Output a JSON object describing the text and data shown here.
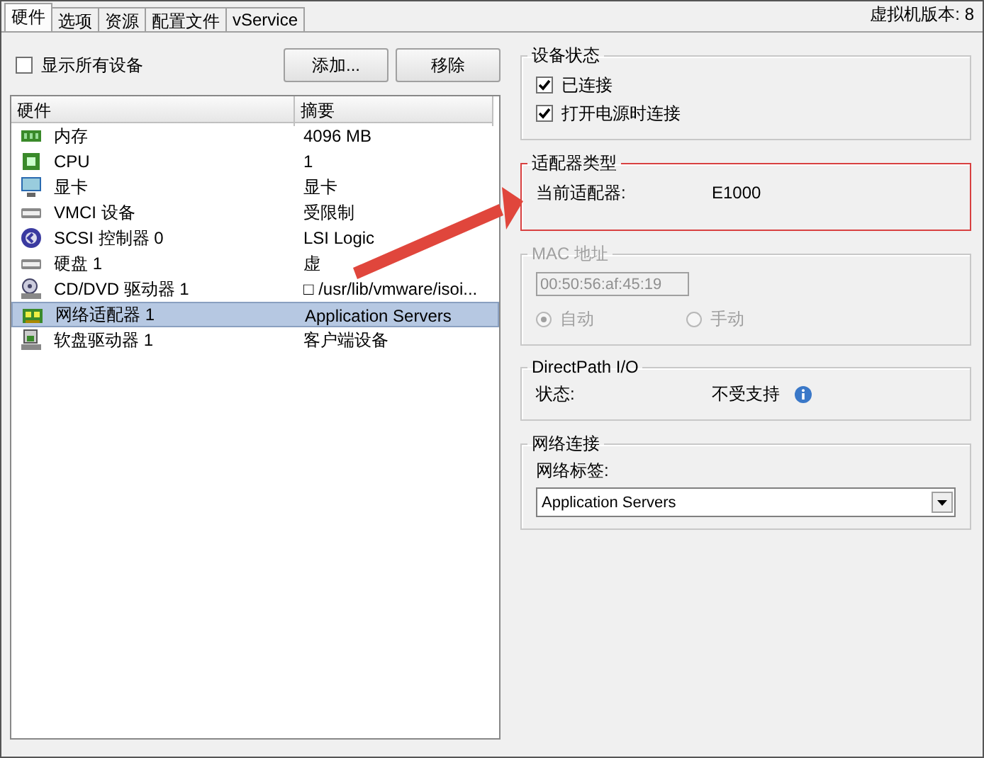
{
  "tabs": [
    {
      "label": "硬件",
      "selected": true
    },
    {
      "label": "选项",
      "selected": false
    },
    {
      "label": "资源",
      "selected": false
    },
    {
      "label": "配置文件",
      "selected": false
    },
    {
      "label": "vService",
      "selected": false
    }
  ],
  "vm_version": "虚拟机版本: 8",
  "show_all_devices": {
    "label": "显示所有设备",
    "checked": false
  },
  "buttons": [
    "添加...",
    "移除"
  ],
  "hardware_table": {
    "columns": [
      "硬件",
      "摘要"
    ],
    "rows": [
      {
        "kind": "memory",
        "name": "内存",
        "summary": "4096 MB",
        "selected": false
      },
      {
        "kind": "cpu",
        "name": "CPU",
        "summary": "1",
        "selected": false
      },
      {
        "kind": "display",
        "name": "显卡",
        "summary": "显卡",
        "selected": false
      },
      {
        "kind": "vmci",
        "name": "VMCI 设备",
        "summary": "受限制",
        "selected": false
      },
      {
        "kind": "scsi",
        "name": "SCSI 控制器 0",
        "summary": "LSI Logic",
        "selected": false
      },
      {
        "kind": "disk",
        "name": "硬盘 1",
        "summary": "虚",
        "selected": false
      },
      {
        "kind": "cdrom",
        "name": "CD/DVD 驱动器 1",
        "summary": "□ /usr/lib/vmware/isoi...",
        "selected": false
      },
      {
        "kind": "network",
        "name": "网络适配器 1",
        "summary": "Application Servers",
        "selected": true
      },
      {
        "kind": "floppy",
        "name": "软盘驱动器 1",
        "summary": "客户端设备",
        "selected": false
      }
    ]
  },
  "device_status": {
    "title": "设备状态",
    "highlighted": false,
    "options": [
      {
        "label": "已连接",
        "checked": true
      },
      {
        "label": "打开电源时连接",
        "checked": true
      }
    ]
  },
  "adapter_type": {
    "title": "适配器类型",
    "highlighted": true,
    "label": "当前适配器:",
    "value": "E1000"
  },
  "mac_address": {
    "title": "MAC 地址",
    "highlighted": false,
    "disabled": true,
    "value": "00:50:56:af:45:19",
    "modes": [
      {
        "label": "自动",
        "selected": true
      },
      {
        "label": "手动",
        "selected": false
      }
    ]
  },
  "directpath": {
    "title": "DirectPath I/O",
    "highlighted": false,
    "label": "状态:",
    "value": "不受支持"
  },
  "network_connection": {
    "title": "网络连接",
    "highlighted": false,
    "label": "网络标签:",
    "value": "Application Servers"
  }
}
